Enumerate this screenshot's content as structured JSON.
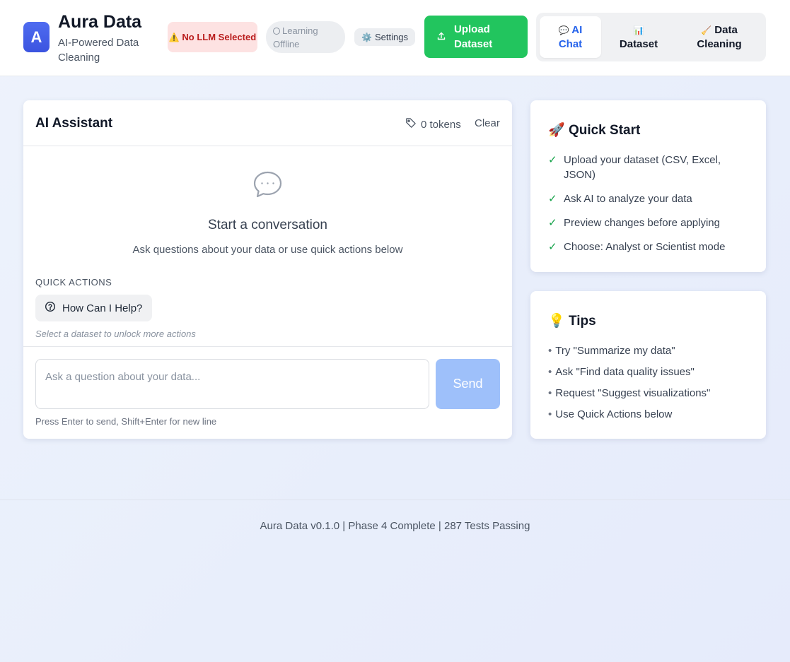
{
  "header": {
    "logo_letter": "A",
    "title": "Aura Data",
    "subtitle": "AI-Powered Data Cleaning",
    "llm_badge": {
      "icon": "⚠️",
      "label": "No LLM Selected"
    },
    "learning_badge": {
      "label": "Learning Offline"
    },
    "settings": {
      "icon": "⚙️",
      "label": "Settings"
    },
    "upload": {
      "icon": "upload-icon",
      "label": "Upload Dataset"
    },
    "tabs": [
      {
        "icon": "💬",
        "label": "AI Chat",
        "active": true
      },
      {
        "icon": "📊",
        "label": "Dataset",
        "active": false
      },
      {
        "icon": "🧹",
        "label": "Data Cleaning",
        "active": false
      }
    ]
  },
  "chat": {
    "title": "AI Assistant",
    "tokens": "0 tokens",
    "clear_label": "Clear",
    "empty_title": "Start a conversation",
    "empty_subtitle": "Ask questions about your data or use quick actions below",
    "quick_actions_label": "QUICK ACTIONS",
    "quick_actions": [
      {
        "icon": "help-circle-icon",
        "label": "How Can I Help?"
      }
    ],
    "quick_actions_hint": "Select a dataset to unlock more actions",
    "input_placeholder": "Ask a question about your data...",
    "input_value": "",
    "send_label": "Send",
    "input_hint": "Press Enter to send, Shift+Enter for new line"
  },
  "quick_start": {
    "icon": "🚀",
    "title": "Quick Start",
    "check_glyph": "✓",
    "items": [
      "Upload your dataset (CSV, Excel, JSON)",
      "Ask AI to analyze your data",
      "Preview changes before applying",
      "Choose: Analyst or Scientist mode"
    ]
  },
  "tips": {
    "icon": "💡",
    "title": "Tips",
    "bullet": "•",
    "items": [
      "Try \"Summarize my data\"",
      "Ask \"Find data quality issues\"",
      "Request \"Suggest visualizations\"",
      "Use Quick Actions below"
    ]
  },
  "footer": {
    "text": "Aura Data v0.1.0 | Phase 4 Complete | 287 Tests Passing"
  },
  "colors": {
    "accent_blue": "#2563eb",
    "upload_green": "#22c55e",
    "warning_red": "#b91c1c",
    "send_disabled": "#9ec0fa",
    "check_green": "#16a34a"
  }
}
